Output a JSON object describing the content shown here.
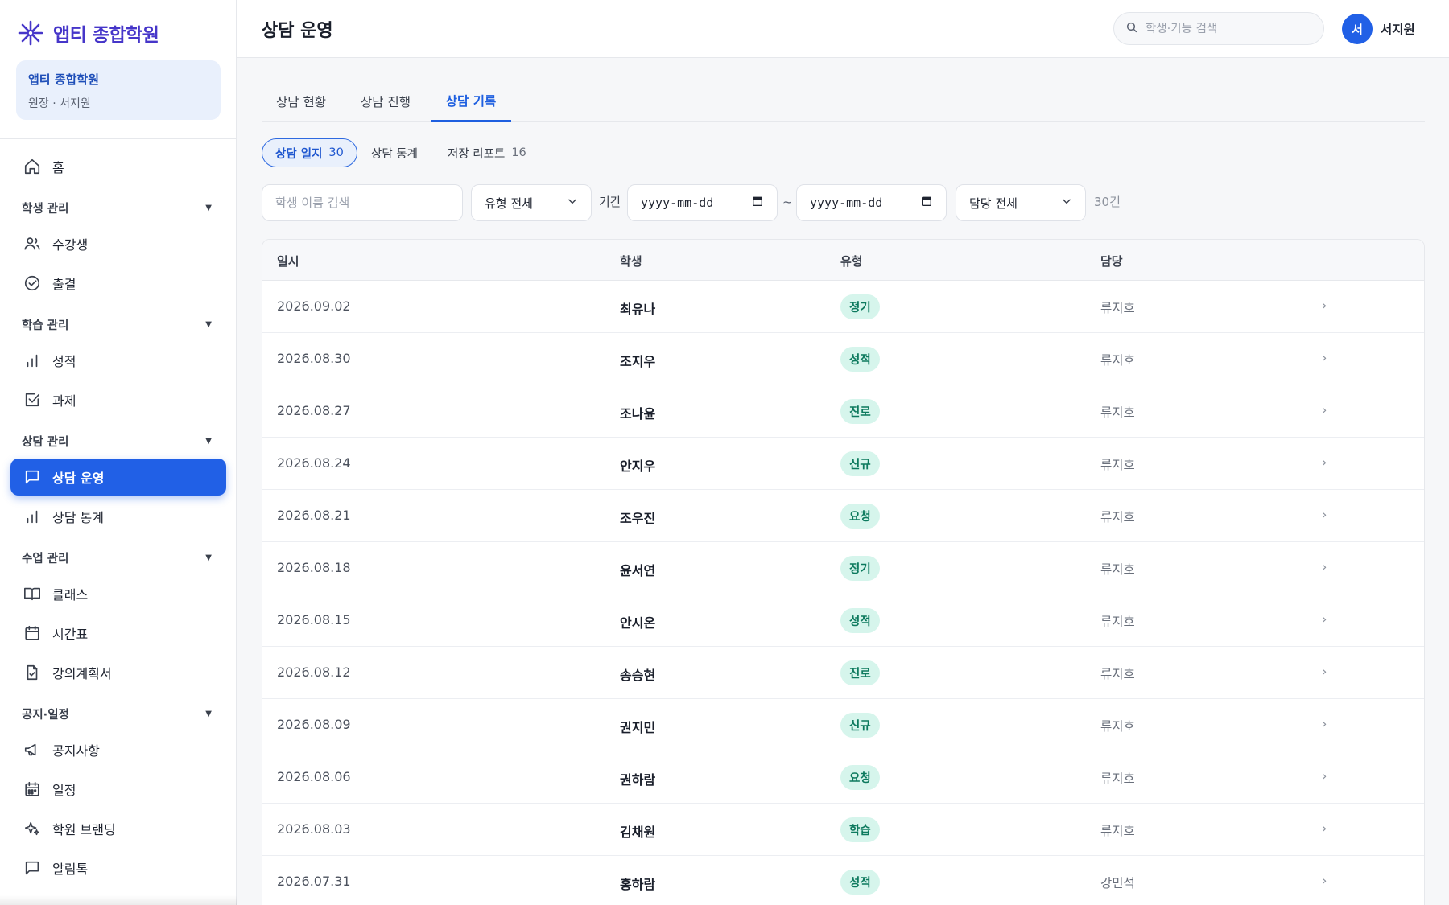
{
  "brand": {
    "name": "앱티 종합학원"
  },
  "org": {
    "title": "앱티 종합학원",
    "subtitle": "원장 · 서지원"
  },
  "sidebar": {
    "home": "홈",
    "sections": [
      {
        "label": "학생 관리",
        "items": [
          "수강생",
          "출결"
        ]
      },
      {
        "label": "학습 관리",
        "items": [
          "성적",
          "과제"
        ]
      },
      {
        "label": "상담 관리",
        "items": [
          "상담 운영",
          "상담 통계"
        ]
      },
      {
        "label": "수업 관리",
        "items": [
          "클래스",
          "시간표",
          "강의계획서"
        ]
      },
      {
        "label": "공지·일정",
        "items": [
          "공지사항",
          "일정",
          "학원 브랜딩",
          "알림톡"
        ]
      }
    ],
    "active": "상담 운영"
  },
  "header": {
    "title": "상담 운영",
    "search_placeholder": "학생·기능 검색",
    "avatar_initial": "서",
    "user_name": "서지원"
  },
  "tabs": [
    "상담 현황",
    "상담 진행",
    "상담 기록"
  ],
  "active_tab": "상담 기록",
  "chips": [
    {
      "label": "상담 일지",
      "count": "30"
    },
    {
      "label": "상담 통계",
      "count": ""
    },
    {
      "label": "저장 리포트",
      "count": "16"
    }
  ],
  "filters": {
    "name_placeholder": "학생 이름 검색",
    "type_select": "유형 전체",
    "period_label": "기간",
    "date_from": "yyyy-mm-dd",
    "tilde": "~",
    "date_to": "yyyy-mm-dd",
    "owner_select": "담당 전체",
    "result_count": "30건"
  },
  "table": {
    "headers": [
      "일시",
      "학생",
      "유형",
      "담당"
    ],
    "rows": [
      {
        "date": "2026.09.02",
        "student": "최유나",
        "type": "정기",
        "owner": "류지호"
      },
      {
        "date": "2026.08.30",
        "student": "조지우",
        "type": "성적",
        "owner": "류지호"
      },
      {
        "date": "2026.08.27",
        "student": "조나윤",
        "type": "진로",
        "owner": "류지호"
      },
      {
        "date": "2026.08.24",
        "student": "안지우",
        "type": "신규",
        "owner": "류지호"
      },
      {
        "date": "2026.08.21",
        "student": "조우진",
        "type": "요청",
        "owner": "류지호"
      },
      {
        "date": "2026.08.18",
        "student": "윤서연",
        "type": "정기",
        "owner": "류지호"
      },
      {
        "date": "2026.08.15",
        "student": "안시온",
        "type": "성적",
        "owner": "류지호"
      },
      {
        "date": "2026.08.12",
        "student": "송승현",
        "type": "진로",
        "owner": "류지호"
      },
      {
        "date": "2026.08.09",
        "student": "권지민",
        "type": "신규",
        "owner": "류지호"
      },
      {
        "date": "2026.08.06",
        "student": "권하람",
        "type": "요청",
        "owner": "류지호"
      },
      {
        "date": "2026.08.03",
        "student": "김채원",
        "type": "학습",
        "owner": "류지호"
      },
      {
        "date": "2026.07.31",
        "student": "홍하람",
        "type": "성적",
        "owner": "강민석"
      }
    ],
    "row_arrow": "›"
  },
  "colors": {
    "accent": "#2160e6",
    "brand": "#4636c9",
    "type_badge_bg": "#d6f5ec",
    "type_badge_text": "#0d7a5e"
  }
}
